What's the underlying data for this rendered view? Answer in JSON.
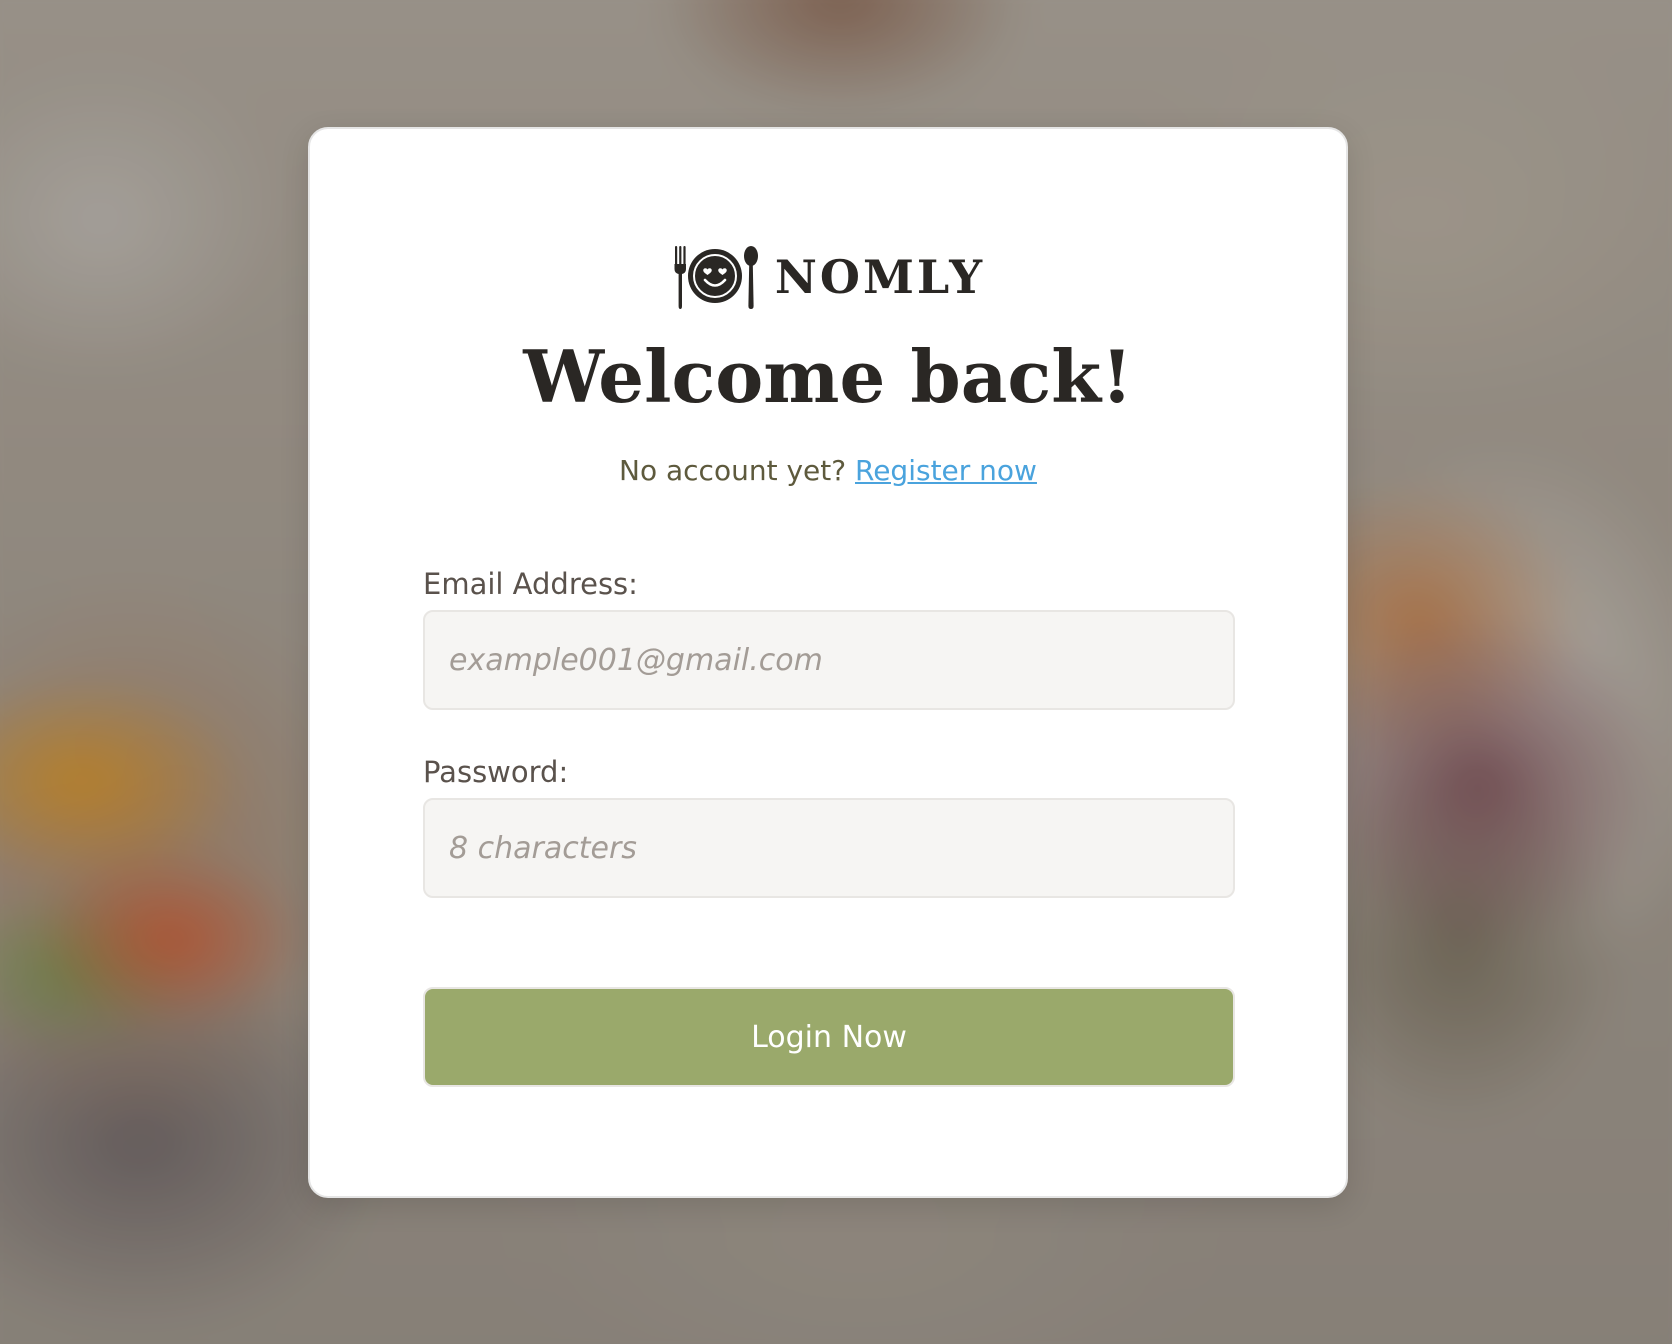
{
  "background": {
    "image_description": "blurred-food-photo"
  },
  "brand": {
    "name": "NOMLY",
    "logo_icon": "plate-fork-spoon-smiley-icon",
    "text_color": "#2a2724"
  },
  "login": {
    "title": "Welcome back!",
    "no_account_text": "No account yet?",
    "register_link": "Register now",
    "email_label": "Email Address:",
    "email_placeholder": "example001@gmail.com",
    "email_value": "",
    "password_label": "Password:",
    "password_placeholder": "8 characters",
    "password_value": "",
    "submit_label": "Login Now"
  },
  "colors": {
    "accent_button": "#9aa96b",
    "link": "#4aa3dd",
    "subtitle": "#5e5a3d",
    "label": "#5a524c",
    "input_bg": "#f6f5f3"
  }
}
